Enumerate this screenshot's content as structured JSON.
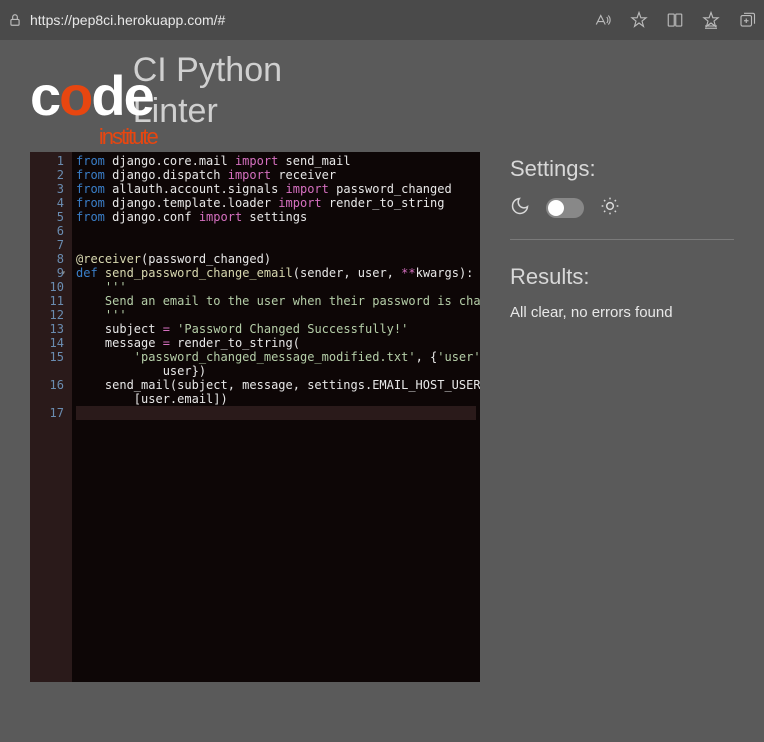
{
  "browser": {
    "url": "https://pep8ci.herokuapp.com/#"
  },
  "header": {
    "logo_text_1": "c",
    "logo_text_o": "o",
    "logo_text_2": "de",
    "logo_sub": "institute",
    "title": "CI Python\nLinter"
  },
  "editor": {
    "lines": [
      {
        "n": "1",
        "html": "<span class='kw'>from</span> django.core.mail <span class='im'>import</span> send_mail"
      },
      {
        "n": "2",
        "html": "<span class='kw'>from</span> django.dispatch <span class='im'>import</span> receiver"
      },
      {
        "n": "3",
        "html": "<span class='kw'>from</span> allauth.account.signals <span class='im'>import</span> password_changed"
      },
      {
        "n": "4",
        "html": "<span class='kw'>from</span> django.template.loader <span class='im'>import</span> render_to_string"
      },
      {
        "n": "5",
        "html": "<span class='kw'>from</span> django.conf <span class='im'>import</span> settings"
      },
      {
        "n": "6",
        "html": ""
      },
      {
        "n": "7",
        "html": ""
      },
      {
        "n": "8",
        "html": "<span class='fn'>@receiver</span>(password_changed)"
      },
      {
        "n": "9",
        "fold": true,
        "html": "<span class='def'>def</span> <span class='fn'>send_password_change_email</span>(sender, user, <span class='op'>**</span>kwargs):"
      },
      {
        "n": "10",
        "html": "    <span class='com'>'''</span>"
      },
      {
        "n": "11",
        "html": "    <span class='com'>Send an email to the user when their password is changed</span>"
      },
      {
        "n": "12",
        "html": "    <span class='com'>'''</span>"
      },
      {
        "n": "13",
        "html": "    subject <span class='op'>=</span> <span class='str'>'Password Changed Successfully!'</span>"
      },
      {
        "n": "14",
        "html": "    message <span class='op'>=</span> render_to_string("
      },
      {
        "n": "15",
        "html": "        <span class='str'>'password_changed_message_modified.txt'</span>, {<span class='str'>'user'</span>:\n            user})"
      },
      {
        "n": "16",
        "html": "    send_mail(subject, message, settings.EMAIL_HOST_USER,\n        [user.email])"
      },
      {
        "n": "17",
        "cursor": true,
        "html": ""
      }
    ]
  },
  "sidebar": {
    "settings_label": "Settings:",
    "results_label": "Results:",
    "results_text": "All clear, no errors found"
  }
}
